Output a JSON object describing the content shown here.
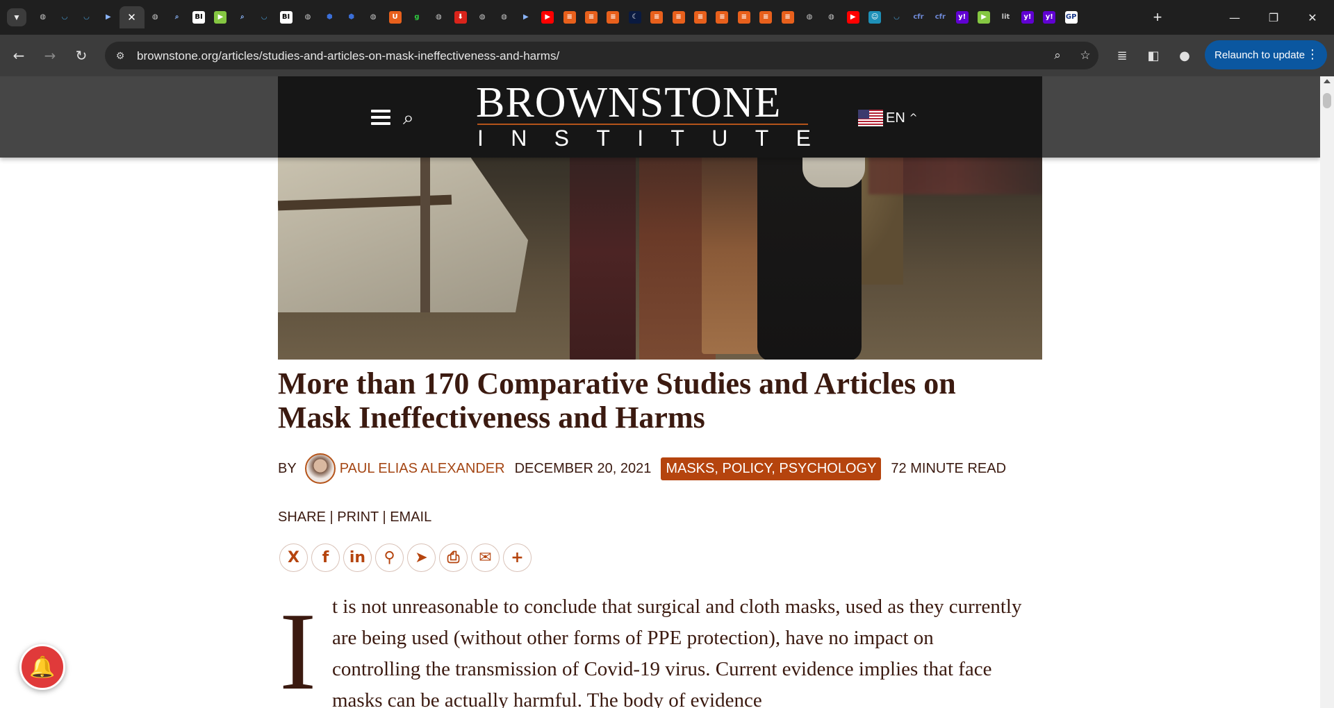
{
  "browser": {
    "url": "brownstone.org/articles/studies-and-articles-on-mask-ineffectiveness-and-harms/",
    "relaunch_label": "Relaunch to update",
    "new_tab_label": "+",
    "tab_favicons": [
      {
        "icon": "globe-icon",
        "glyph": "◍",
        "bg": "transparent",
        "fg": "#c8c8c8"
      },
      {
        "icon": "shield-icon",
        "glyph": "◡",
        "bg": "transparent",
        "fg": "#4aa3df"
      },
      {
        "icon": "shield-icon",
        "glyph": "◡",
        "bg": "transparent",
        "fg": "#4aa3df"
      },
      {
        "icon": "arrow-icon",
        "glyph": "▶",
        "bg": "transparent",
        "fg": "#8ab4f8"
      },
      {
        "icon": "close-icon",
        "glyph": "✕",
        "bg": "transparent",
        "fg": "#ffffff"
      },
      {
        "icon": "globe-icon",
        "glyph": "◍",
        "bg": "transparent",
        "fg": "#c8c8c8"
      },
      {
        "icon": "search-icon",
        "glyph": "⌕",
        "bg": "transparent",
        "fg": "#8ab4f8"
      },
      {
        "icon": "bi-icon",
        "glyph": "BI",
        "bg": "#ffffff",
        "fg": "#000000"
      },
      {
        "icon": "rumble-icon",
        "glyph": "▶",
        "bg": "#85c742",
        "fg": "#ffffff"
      },
      {
        "icon": "search-icon",
        "glyph": "⌕",
        "bg": "transparent",
        "fg": "#8ab4f8"
      },
      {
        "icon": "shield-icon",
        "glyph": "◡",
        "bg": "transparent",
        "fg": "#4aa3df"
      },
      {
        "icon": "bi-icon",
        "glyph": "BI",
        "bg": "#ffffff",
        "fg": "#000000"
      },
      {
        "icon": "globe-icon",
        "glyph": "◍",
        "bg": "transparent",
        "fg": "#c8c8c8"
      },
      {
        "icon": "hex-icon",
        "glyph": "⬢",
        "bg": "transparent",
        "fg": "#3b6fd8"
      },
      {
        "icon": "hex-icon",
        "glyph": "⬢",
        "bg": "transparent",
        "fg": "#3b6fd8"
      },
      {
        "icon": "globe-icon",
        "glyph": "◍",
        "bg": "transparent",
        "fg": "#c8c8c8"
      },
      {
        "icon": "shield-icon",
        "glyph": "U",
        "bg": "#e8601c",
        "fg": "#ffffff"
      },
      {
        "icon": "g-icon",
        "glyph": "g",
        "bg": "transparent",
        "fg": "#2ecc40"
      },
      {
        "icon": "globe-icon",
        "glyph": "◍",
        "bg": "transparent",
        "fg": "#c8c8c8"
      },
      {
        "icon": "pin-icon",
        "glyph": "⬇",
        "bg": "#d9241b",
        "fg": "#ffffff"
      },
      {
        "icon": "globe-icon",
        "glyph": "◍",
        "bg": "transparent",
        "fg": "#c8c8c8"
      },
      {
        "icon": "globe-icon",
        "glyph": "◍",
        "bg": "transparent",
        "fg": "#c8c8c8"
      },
      {
        "icon": "arrow-icon",
        "glyph": "▶",
        "bg": "transparent",
        "fg": "#8ab4f8"
      },
      {
        "icon": "youtube-icon",
        "glyph": "▶",
        "bg": "#ff0000",
        "fg": "#ffffff"
      },
      {
        "icon": "bookmark-icon",
        "glyph": "≡",
        "bg": "#e8601c",
        "fg": "#ffffff"
      },
      {
        "icon": "bookmark-icon",
        "glyph": "≡",
        "bg": "#e8601c",
        "fg": "#ffffff"
      },
      {
        "icon": "bookmark-icon",
        "glyph": "≡",
        "bg": "#e8601c",
        "fg": "#ffffff"
      },
      {
        "icon": "moon-icon",
        "glyph": "☾",
        "bg": "#0a1a40",
        "fg": "#ffffff"
      },
      {
        "icon": "bookmark-icon",
        "glyph": "≡",
        "bg": "#e8601c",
        "fg": "#ffffff"
      },
      {
        "icon": "bookmark-icon",
        "glyph": "≡",
        "bg": "#e8601c",
        "fg": "#ffffff"
      },
      {
        "icon": "bookmark-icon",
        "glyph": "≡",
        "bg": "#e8601c",
        "fg": "#ffffff"
      },
      {
        "icon": "bookmark-icon",
        "glyph": "≡",
        "bg": "#e8601c",
        "fg": "#ffffff"
      },
      {
        "icon": "bookmark-icon",
        "glyph": "≡",
        "bg": "#e8601c",
        "fg": "#ffffff"
      },
      {
        "icon": "bookmark-icon",
        "glyph": "≡",
        "bg": "#e8601c",
        "fg": "#ffffff"
      },
      {
        "icon": "bookmark-icon",
        "glyph": "≡",
        "bg": "#e8601c",
        "fg": "#ffffff"
      },
      {
        "icon": "globe-icon",
        "glyph": "◍",
        "bg": "transparent",
        "fg": "#c8c8c8"
      },
      {
        "icon": "globe-icon",
        "glyph": "◍",
        "bg": "transparent",
        "fg": "#c8c8c8"
      },
      {
        "icon": "youtube-icon",
        "glyph": "▶",
        "bg": "#ff0000",
        "fg": "#ffffff"
      },
      {
        "icon": "face-icon",
        "glyph": "☺",
        "bg": "#1e90b8",
        "fg": "#ffffff"
      },
      {
        "icon": "shield-icon",
        "glyph": "◡",
        "bg": "transparent",
        "fg": "#4aa3df"
      },
      {
        "icon": "cfr-icon",
        "glyph": "cfr",
        "bg": "transparent",
        "fg": "#6f8ad8"
      },
      {
        "icon": "cfr-icon",
        "glyph": "cfr",
        "bg": "transparent",
        "fg": "#6f8ad8"
      },
      {
        "icon": "yahoo-icon",
        "glyph": "y!",
        "bg": "#6001d2",
        "fg": "#ffffff"
      },
      {
        "icon": "rumble-icon",
        "glyph": "▶",
        "bg": "#85c742",
        "fg": "#ffffff"
      },
      {
        "icon": "lit-icon",
        "glyph": "lit",
        "bg": "transparent",
        "fg": "#c8c8c8"
      },
      {
        "icon": "yahoo-icon",
        "glyph": "y!",
        "bg": "#6001d2",
        "fg": "#ffffff"
      },
      {
        "icon": "yahoo-icon",
        "glyph": "y!",
        "bg": "#6001d2",
        "fg": "#ffffff"
      },
      {
        "icon": "gp-icon",
        "glyph": "GP",
        "bg": "#ffffff",
        "fg": "#1a3a8a"
      }
    ],
    "active_tab_index": 4
  },
  "site": {
    "logo_main": "BROWNSTONE",
    "logo_sub_letters": [
      "I",
      "N",
      "S",
      "T",
      "I",
      "T",
      "U",
      "T",
      "E"
    ],
    "language": "EN",
    "accent_color": "#b5440e"
  },
  "article": {
    "title": "More than 170 Comparative Studies and Articles on Mask Ineffectiveness and Harms",
    "by_label": "BY",
    "author": "PAUL ELIAS ALEXANDER",
    "date": "DECEMBER 20, 2021",
    "tags": "MASKS, POLICY, PSYCHOLOGY",
    "read_time": "72 MINUTE READ",
    "share_label": "SHARE",
    "print_label": "PRINT",
    "email_label": "EMAIL",
    "share_buttons": [
      {
        "name": "x-share-icon",
        "glyph": "X"
      },
      {
        "name": "facebook-share-icon",
        "glyph": "f"
      },
      {
        "name": "linkedin-share-icon",
        "glyph": "in"
      },
      {
        "name": "gettr-share-icon",
        "glyph": "⚲"
      },
      {
        "name": "telegram-share-icon",
        "glyph": "➤"
      },
      {
        "name": "print-share-icon",
        "glyph": "⎙"
      },
      {
        "name": "email-share-icon",
        "glyph": "✉"
      },
      {
        "name": "more-share-icon",
        "glyph": "+"
      }
    ],
    "drop_cap": "I",
    "body_first": "t is not unreasonable to conclude that surgical and cloth masks, used as they currently are being used (without other forms of PPE protection), have no impact on controlling the transmission of Covid-19 virus. Current evidence implies that face masks can be actually harmful. The body of evidence"
  }
}
